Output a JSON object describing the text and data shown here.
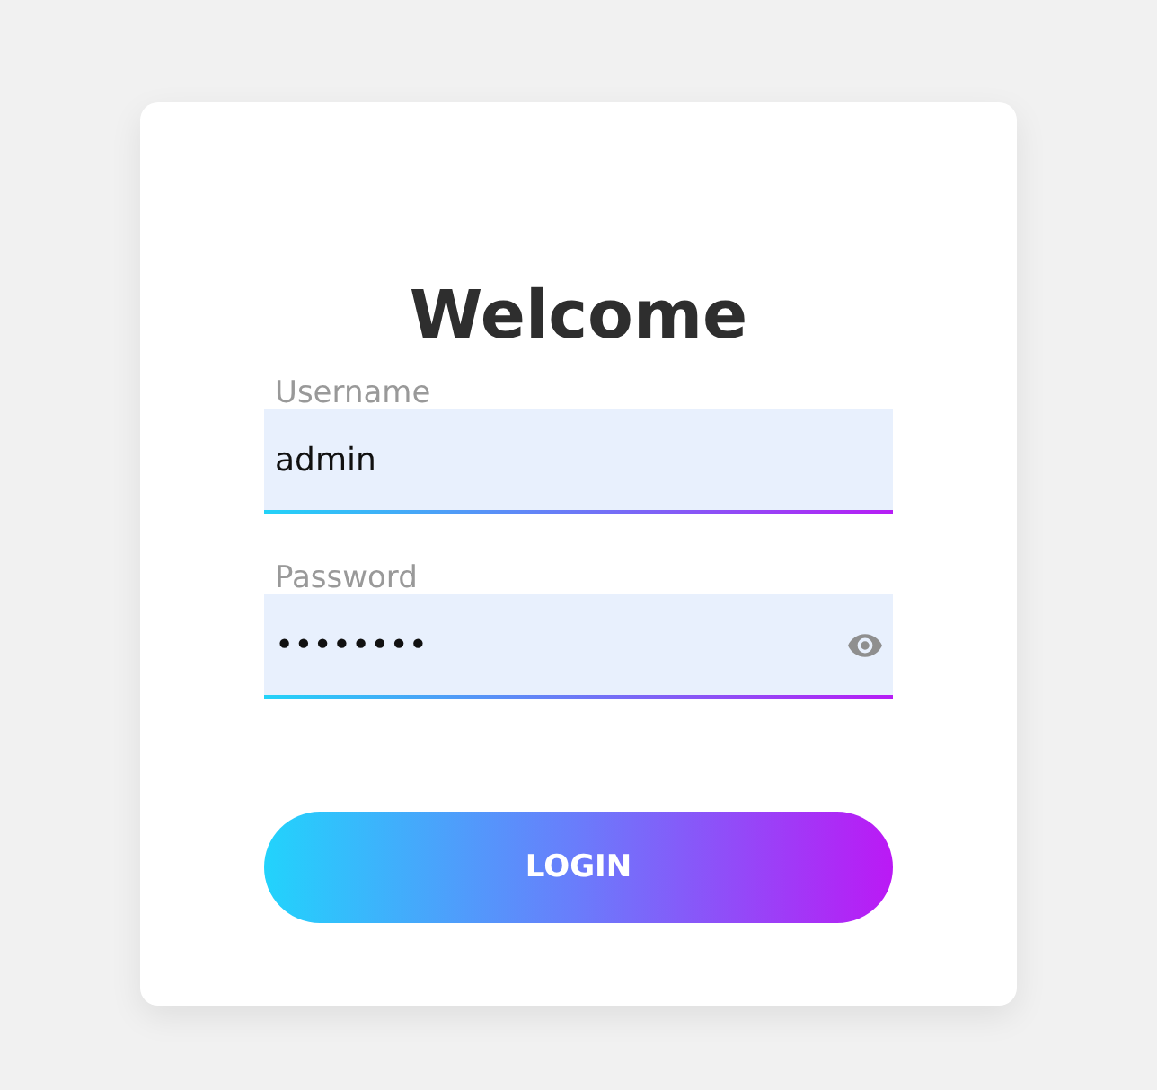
{
  "title": "Welcome",
  "fields": [
    {
      "kind": "text",
      "label": "Username",
      "value": "admin"
    },
    {
      "kind": "password",
      "label": "Password",
      "value": "••••••••"
    }
  ],
  "button": "LOGIN"
}
